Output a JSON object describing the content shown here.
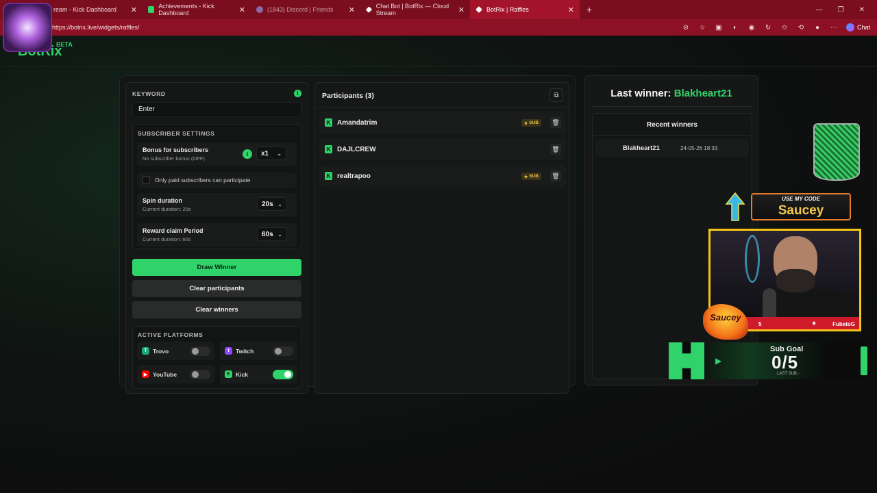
{
  "browser": {
    "tabs": [
      {
        "label": "ream - Kick Dashboard",
        "icon_color": "#2fd36a"
      },
      {
        "label": "Achievements - Kick Dashboard",
        "icon_color": "#2fd36a"
      },
      {
        "label": "(1843) Discord | Friends",
        "icon_color": "#8a6aa6"
      },
      {
        "label": "Chat Bot | BotRix — Cloud Stream",
        "icon_color": "#ffffff"
      },
      {
        "label": "BotRix | Raffles",
        "icon_color": "#ffffff"
      }
    ],
    "new_tab": "+",
    "url": "https://botrix.live/widgets/raffles/",
    "chat_label": "Chat"
  },
  "site": {
    "logo": "BotRix",
    "beta": "BETA"
  },
  "left_panel": {
    "keyword_label": "KEYWORD",
    "keyword_value": "Enter",
    "subscriber_settings_title": "SUBSCRIBER SETTINGS",
    "bonus_title": "Bonus for subscribers",
    "bonus_desc": "No subscriber bonus (OFF)",
    "bonus_value": "x1",
    "only_paid_label": "Only paid subscribers can participate",
    "spin_title": "Spin duration",
    "spin_desc": "Current duration: 20s",
    "spin_value": "20s",
    "reward_title": "Reward claim Period",
    "reward_desc": "Current duration: 60s",
    "reward_value": "60s",
    "draw_button": "Draw Winner",
    "clear_participants_button": "Clear participants",
    "clear_winners_button": "Clear winners",
    "platforms_title": "ACTIVE PLATFORMS",
    "platforms": [
      {
        "name": "Trovo",
        "on": false,
        "color": "#19a974"
      },
      {
        "name": "Twitch",
        "on": false,
        "color": "#9146ff"
      },
      {
        "name": "YouTube",
        "on": false,
        "color": "#ff0000"
      },
      {
        "name": "Kick",
        "on": true,
        "color": "#2fd36a"
      }
    ]
  },
  "participants": {
    "title": "Participants (3)",
    "items": [
      {
        "name": "Amandatrim",
        "badge": "SUB"
      },
      {
        "name": "DAJLCREW",
        "badge": ""
      },
      {
        "name": "realtrapoo",
        "badge": "SUB"
      }
    ]
  },
  "winner_panel": {
    "last_winner_label": "Last winner:",
    "last_winner_name": "Blakheart21",
    "recent_title": "Recent winners",
    "recent": [
      {
        "name": "Blakheart21",
        "time": "24-05-26 18:33"
      }
    ]
  },
  "overlay": {
    "code_top": "USE MY CODE",
    "code_main": "Saucey",
    "cam_bar_text": "FubetoG",
    "cam_bar_num": "5",
    "sub_goal_label": "Sub Goal",
    "sub_goal_value": "0/5",
    "last_sub": "LAST SUB: -"
  },
  "colors": {
    "accent": "#2fd36a",
    "browser_frame": "#7a0e1e"
  }
}
